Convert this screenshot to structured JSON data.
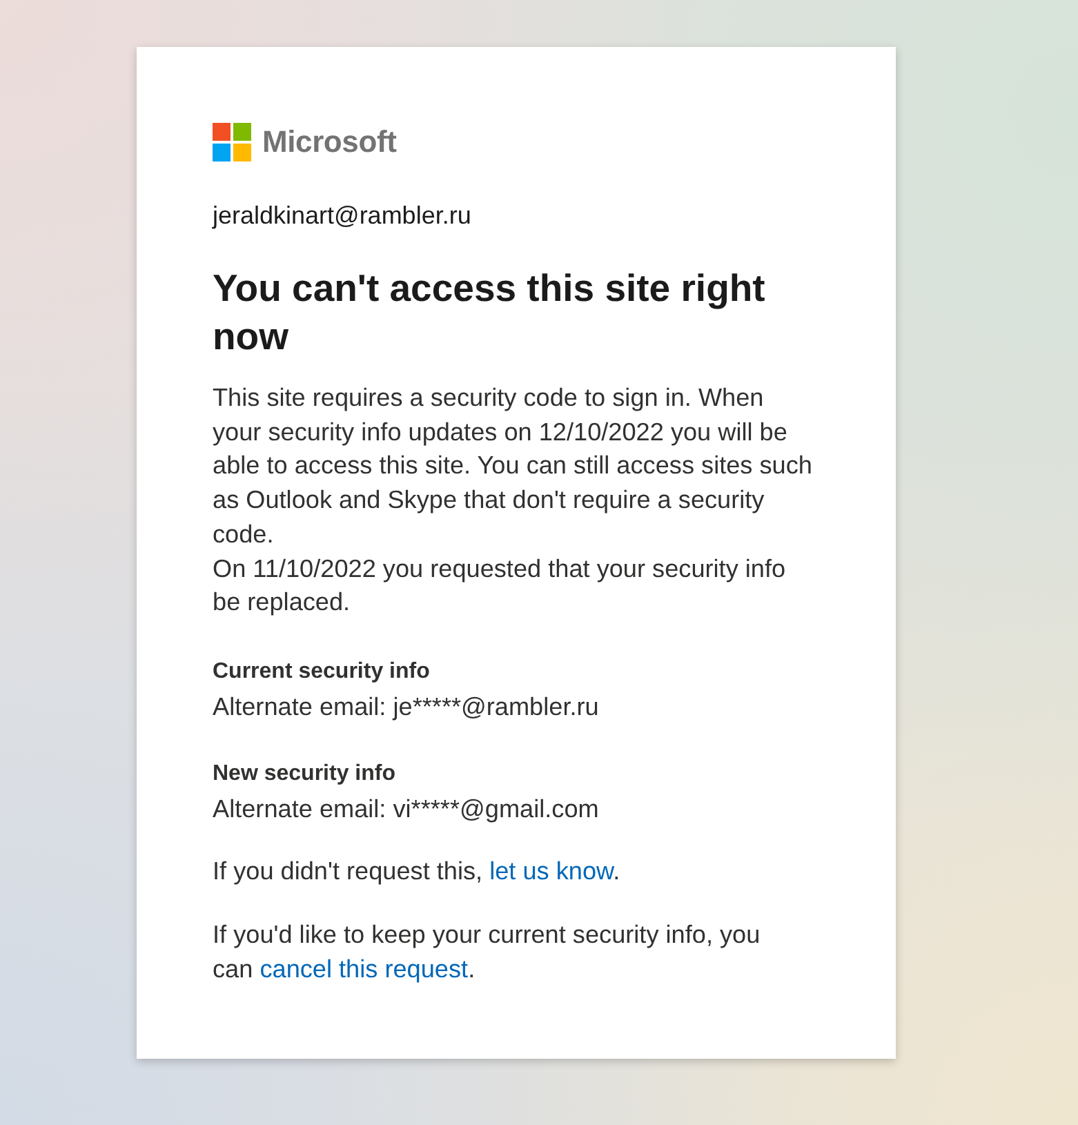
{
  "brand": {
    "name": "Microsoft"
  },
  "account": "jeraldkinart@rambler.ru",
  "title": "You can't access this site right now",
  "paragraphs": [
    "This site requires a security code to sign in. When your security info updates on 12/10/2022 you will be able to access this site. You can still access sites such as Outlook and Skype that don't require a security code.",
    "On 11/10/2022 you requested that your security info be replaced."
  ],
  "sections": [
    {
      "heading": "Current security info",
      "value": "Alternate email: je*****@rambler.ru"
    },
    {
      "heading": "New security info",
      "value": "Alternate email: vi*****@gmail.com"
    }
  ],
  "notes": [
    {
      "before": "If you didn't request this, ",
      "link": "let us know",
      "after": "."
    },
    {
      "before": "If you'd like to keep your current security info, you can ",
      "link": "cancel this request",
      "after": "."
    }
  ]
}
